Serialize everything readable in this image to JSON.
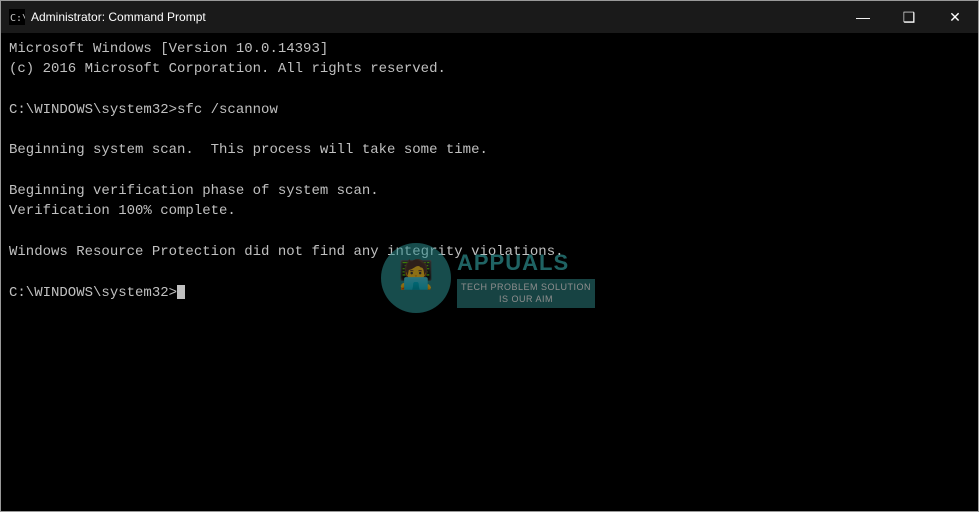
{
  "window": {
    "title": "Administrator: Command Prompt",
    "controls": {
      "minimize": "—",
      "maximize": "❑",
      "close": "✕"
    }
  },
  "console": {
    "lines": [
      "Microsoft Windows [Version 10.0.14393]",
      "(c) 2016 Microsoft Corporation. All rights reserved.",
      "",
      "C:\\WINDOWS\\system32>sfc /scannow",
      "",
      "Beginning system scan.  This process will take some time.",
      "",
      "Beginning verification phase of system scan.",
      "Verification 100% complete.",
      "",
      "Windows Resource Protection did not find any integrity violations.",
      "",
      "C:\\WINDOWS\\system32>"
    ],
    "prompt": "C:\\WINDOWS\\system32>"
  },
  "watermark": {
    "brand": "APPUALS",
    "subtitle": "TECH PROBLEM SOLUTION",
    "subtitle2": "IS OUR AIM"
  }
}
